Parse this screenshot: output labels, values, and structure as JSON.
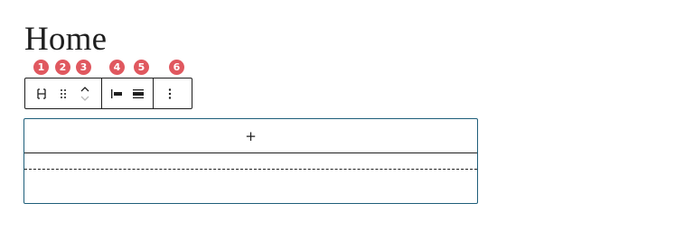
{
  "page": {
    "title": "Home"
  },
  "badges": [
    "1",
    "2",
    "3",
    "4",
    "5",
    "6"
  ],
  "toolbar": {
    "buttons": [
      {
        "name": "select-parent-icon"
      },
      {
        "name": "drag-handle-icon"
      },
      {
        "name": "move-up-down-icon"
      },
      {
        "name": "align-left-icon"
      },
      {
        "name": "align-full-width-icon"
      },
      {
        "name": "more-options-icon"
      }
    ]
  },
  "block": {
    "appender_label": "+"
  },
  "colors": {
    "badge": "#e0585f",
    "block_border": "#1e5e7a",
    "text": "#1e1e1e"
  }
}
